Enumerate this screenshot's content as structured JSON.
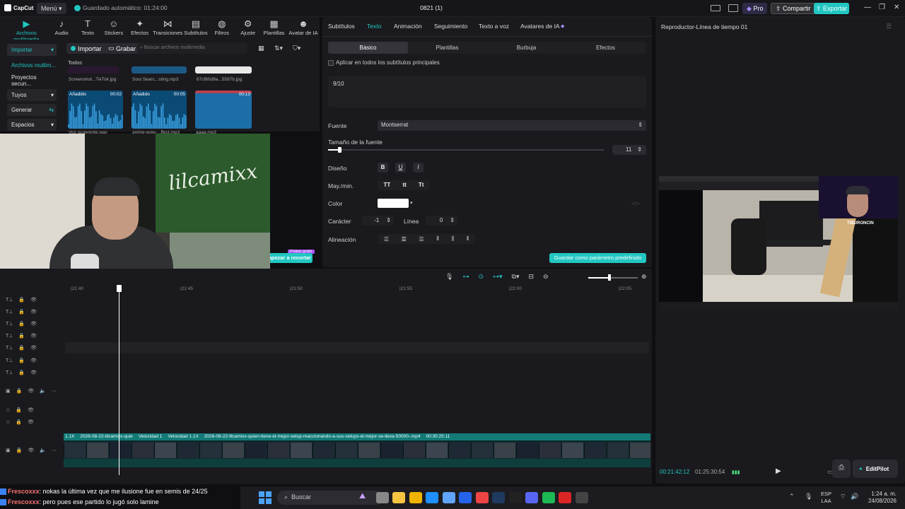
{
  "app": {
    "logo": "CapCut",
    "menu": "Menú",
    "autosave": "Guardado automático: 01:24:00",
    "project_title": "0821 (1)",
    "pro": "Pro",
    "share": "Compartir",
    "export": "Exportar"
  },
  "toolbar": [
    "Archivos multimedia",
    "Audio",
    "Texto",
    "Stickers",
    "Efectos",
    "Transiciones",
    "Subtítulos",
    "Filtros",
    "Ajuste",
    "Plantillas",
    "Avatar de IA"
  ],
  "toolbar_icons": [
    "media-icon",
    "audio-icon",
    "text-icon",
    "sticker-icon",
    "effects-icon",
    "transitions-icon",
    "subtitles-icon",
    "filters-icon",
    "adjust-icon",
    "templates-icon",
    "avatar-icon"
  ],
  "media": {
    "import": "Importar",
    "record": "Grabar",
    "search_placeholder": "Buscar archivos multimedia",
    "all": "Todos",
    "sidebar": [
      "Importar",
      "Archivos multim...",
      "Proyectos secun...",
      "Tuyos",
      "Generar",
      "Espacios"
    ],
    "top_files": [
      "Screenshot...TikTok.jpg",
      "Soul Searc...sting.mp3",
      "67cf60d9a...5597b.jpg"
    ],
    "clips": [
      {
        "tag": "Añadido",
        "dur": "00:02",
        "name": "Voz sugerente.wav"
      },
      {
        "tag": "Añadido",
        "dur": "00:05",
        "name": "anime-wow-...ffect.mp3"
      },
      {
        "tag": "",
        "dur": "00:13",
        "name": "aaaa.mp3"
      }
    ],
    "new_badge": "Probar gratis",
    "crop_btn": "Empezar a recortar"
  },
  "props": {
    "tabs": [
      "Subtítulos",
      "Texto",
      "Animación",
      "Seguimiento",
      "Texto a voz",
      "Avatares de IA"
    ],
    "subtabs": [
      "Básico",
      "Plantillas",
      "Burbuja",
      "Efectos"
    ],
    "apply_all": "Aplicar en todos los subtítulos principales",
    "text_value": "9/10",
    "font_label": "Fuente",
    "font_value": "Montserrat",
    "size_label": "Tamaño de la fuente",
    "size_value": "11",
    "size_level": 0.02,
    "design_label": "Diseño",
    "design_btns": [
      "B",
      "U",
      "I"
    ],
    "case_label": "May./min.",
    "case_btns": [
      "TT",
      "tt",
      "Tt"
    ],
    "color_label": "Color",
    "color_value": "#ffffff",
    "char_label": "Carácter",
    "char_value": "-1",
    "line_label": "Línea",
    "line_value": "0",
    "align_label": "Alineación",
    "save_default": "Guardar como parámetro predefinido"
  },
  "player": {
    "title": "Reproductor-Línea de tiempo 01",
    "current": "00:21:42:12",
    "total": "01:25:30:54",
    "editpilot": "EditPilot",
    "overlay_name": "TIBURONCIN"
  },
  "timeline": {
    "ticks": [
      "|21:40",
      "|21:45",
      "|21:50",
      "|21:55",
      "|22:00",
      "|22:05"
    ],
    "clip_labels": [
      "1.1X",
      "2026-08-22-lilcamixx-quie",
      "Velocidad 1",
      "Velocidad 1.1X",
      "2026-08-22-lilcamixx-quien-tiene-el-mejor-setup-reaccionando-a-sus-setups-el-mejor-se-lleva-50000-.mp4",
      "00:30:25:11"
    ]
  },
  "chat": [
    {
      "user": "Frescoxxx",
      "msg": ": nokas la última vez que me ilusione fue en semis de 24/25"
    },
    {
      "user": "Frescoxxx",
      "msg": ": pero pues ese partido lo jugó solo lamine"
    }
  ],
  "taskbar": {
    "search": "Buscar",
    "lang1": "ESP",
    "lang2": "LAA",
    "time": "1:24 a. m.",
    "date": "24/08/2026"
  }
}
